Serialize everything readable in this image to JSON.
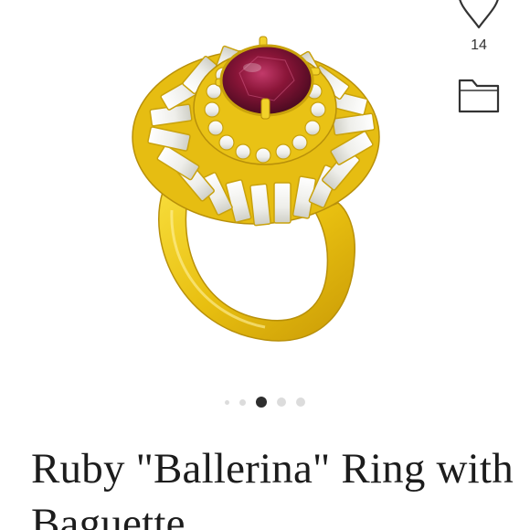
{
  "icons": {
    "like": "heart-outline-icon",
    "save": "folder-icon"
  },
  "actions": {
    "like_count": "14"
  },
  "carousel": {
    "total_images": 5,
    "active_index": 2,
    "active_color": "#2e2e2e",
    "inactive_color": "#dcdcdc"
  },
  "product": {
    "title": "Ruby \"Ballerina\" Ring with Baguette"
  },
  "colors": {
    "gold": "#e8c21a",
    "ruby": "#8a1538",
    "diamond": "#f4f4f2",
    "text": "#1c1c1c"
  }
}
